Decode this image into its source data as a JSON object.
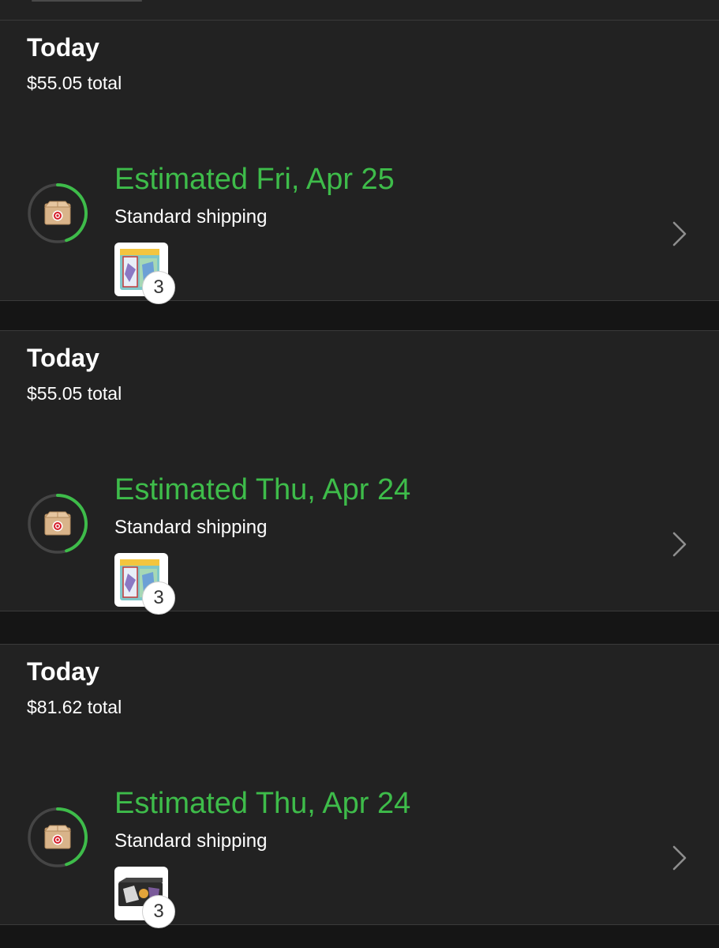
{
  "colors": {
    "accent_green": "#3ebc4a",
    "card_bg": "#222222",
    "page_bg": "#151515",
    "text": "#ffffff",
    "chevron": "#8e8e8e"
  },
  "orders": [
    {
      "date": "Today",
      "total": "$55.05 total",
      "shipment": {
        "eta": "Estimated Fri, Apr 25",
        "method": "Standard shipping",
        "progress_fraction": 0.45,
        "item_image": "trading-card-pack",
        "item_count": "3"
      }
    },
    {
      "date": "Today",
      "total": "$55.05 total",
      "shipment": {
        "eta": "Estimated Thu, Apr 24",
        "method": "Standard shipping",
        "progress_fraction": 0.45,
        "item_image": "trading-card-pack",
        "item_count": "3"
      }
    },
    {
      "date": "Today",
      "total": "$81.62 total",
      "shipment": {
        "eta": "Estimated Thu, Apr 24",
        "method": "Standard shipping",
        "progress_fraction": 0.45,
        "item_image": "trading-card-box",
        "item_count": "3"
      }
    }
  ],
  "icons": {
    "status": "package-box-icon",
    "navigate": "chevron-right-icon"
  }
}
